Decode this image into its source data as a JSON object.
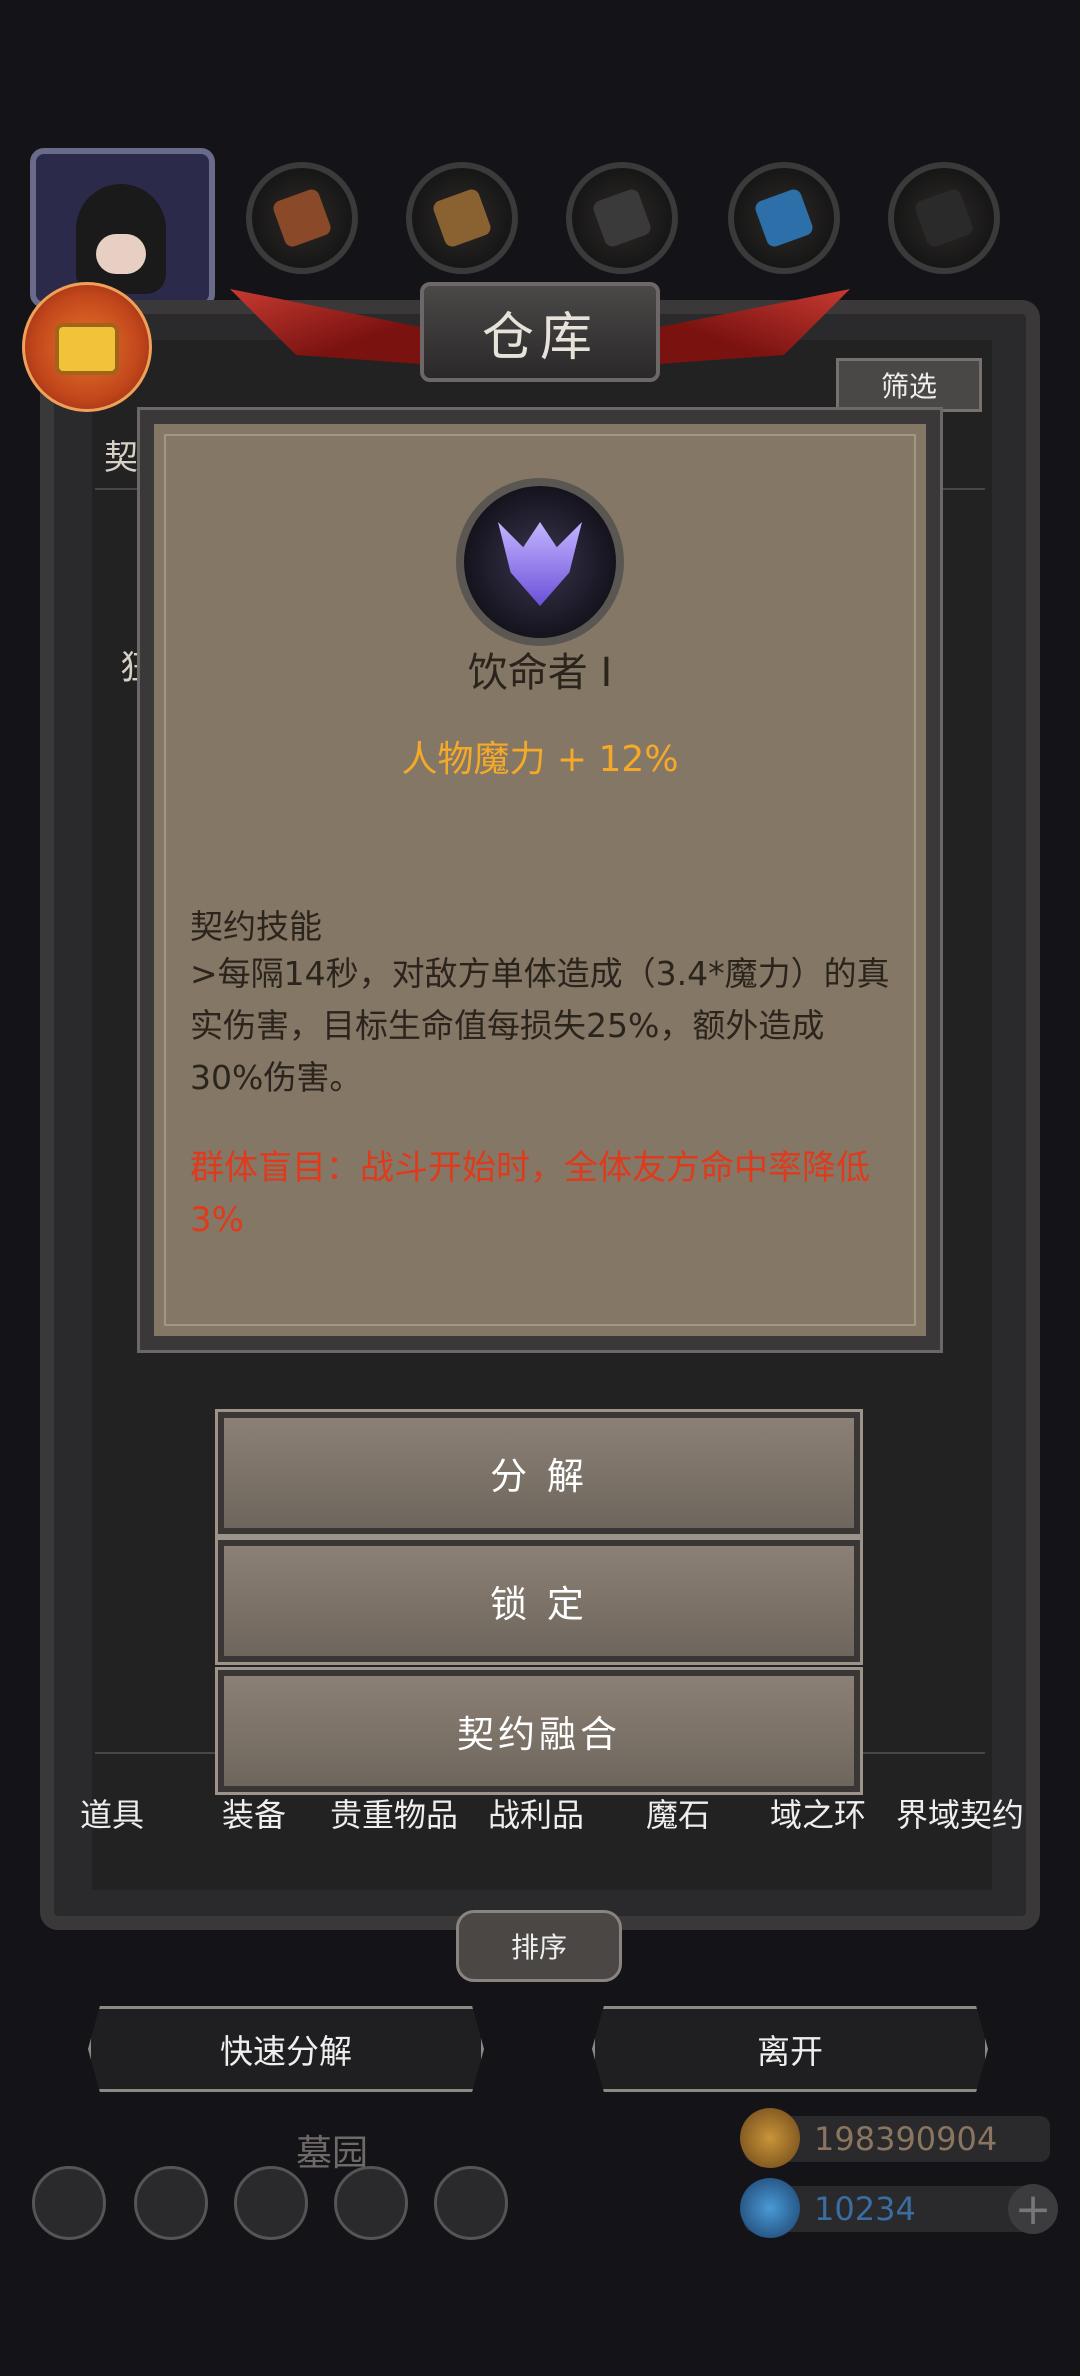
{
  "header": {
    "title": "仓库",
    "filter_label": "筛选"
  },
  "background": {
    "side_label_1": "契",
    "side_label_2": "狂"
  },
  "popup": {
    "name": "饮命者 I",
    "stat": "人物魔力 + 12%",
    "section_heading": "契约技能",
    "description": ">每隔14秒，对敌方单体造成（3.4*魔力）的真实伤害，目标生命值每损失25%，额外造成30%伤害。",
    "penalty": "群体盲目：战斗开始时，全体友方命中率降低3%"
  },
  "actions": {
    "decompose": "分 解",
    "lock": "锁 定",
    "fuse": "契约融合"
  },
  "tabs": [
    "道具",
    "装备",
    "贵重物品",
    "战利品",
    "魔石",
    "域之环",
    "界域契约"
  ],
  "bottom": {
    "sort_label": "排序",
    "quick_decompose": "快速分解",
    "leave": "离开",
    "location": "墓园"
  },
  "currency": {
    "gold": "198390904",
    "gems": "10234"
  },
  "colors": {
    "stat_gold": "#f5a928",
    "penalty_red": "#e03a1c",
    "popup_bg": "#857766"
  }
}
